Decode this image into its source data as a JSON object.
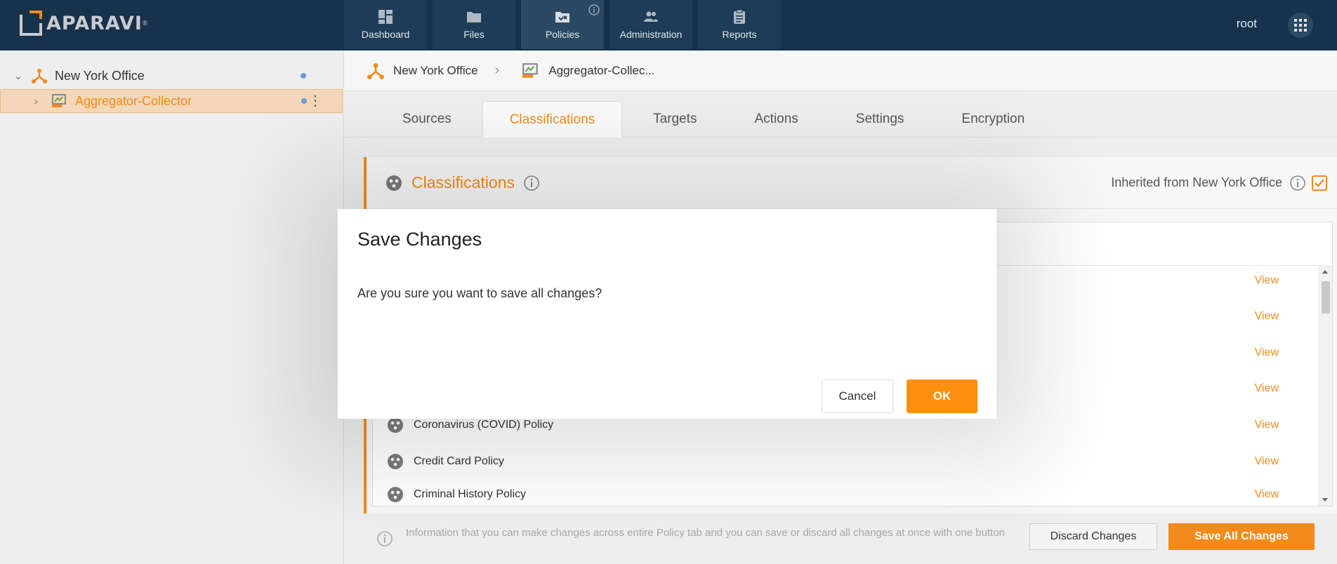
{
  "topbar": {
    "logo_text": "APARAVI",
    "logo_reg": "®",
    "nav": [
      {
        "label": "Dashboard",
        "icon": "dashboard-icon"
      },
      {
        "label": "Files",
        "icon": "folder-icon"
      },
      {
        "label": "Policies",
        "icon": "policy-folder-icon"
      },
      {
        "label": "Administration",
        "icon": "users-icon"
      },
      {
        "label": "Reports",
        "icon": "clipboard-icon"
      }
    ],
    "active_nav": "Policies",
    "user": "root"
  },
  "tree": {
    "items": [
      {
        "label": "New York Office",
        "icon": "network-icon",
        "expanded": true
      },
      {
        "label": "Aggregator-Collector",
        "icon": "aggregator-icon",
        "selected": true
      }
    ]
  },
  "breadcrumb": {
    "items": [
      "New York Office",
      "Aggregator-Collec..."
    ]
  },
  "subtabs": {
    "items": [
      "Sources",
      "Classifications",
      "Targets",
      "Actions",
      "Settings",
      "Encryption"
    ],
    "active": "Classifications"
  },
  "panel": {
    "title": "Classifications",
    "inherited_label": "Inherited from New York Office",
    "inherited_checked": true,
    "rows": [
      {
        "label": "",
        "view": "View"
      },
      {
        "label": "",
        "view": "View"
      },
      {
        "label": "",
        "view": "View"
      },
      {
        "label": "",
        "view": "View"
      },
      {
        "label": "Coronavirus (COVID) Policy",
        "view": "View"
      },
      {
        "label": "Credit Card Policy",
        "view": "View"
      },
      {
        "label": "Criminal History Policy",
        "view": "View"
      }
    ]
  },
  "bottom": {
    "info": "Information that you can make changes across entire Policy tab and you can save or discard all changes at once with one button",
    "discard": "Discard Changes",
    "save_all": "Save All Changes"
  },
  "modal": {
    "title": "Save Changes",
    "message": "Are you sure you want to save all changes?",
    "cancel": "Cancel",
    "ok": "OK"
  },
  "colors": {
    "accent": "#f28a1c",
    "topbar": "#17324a",
    "ok_button": "#ff8f0f"
  }
}
